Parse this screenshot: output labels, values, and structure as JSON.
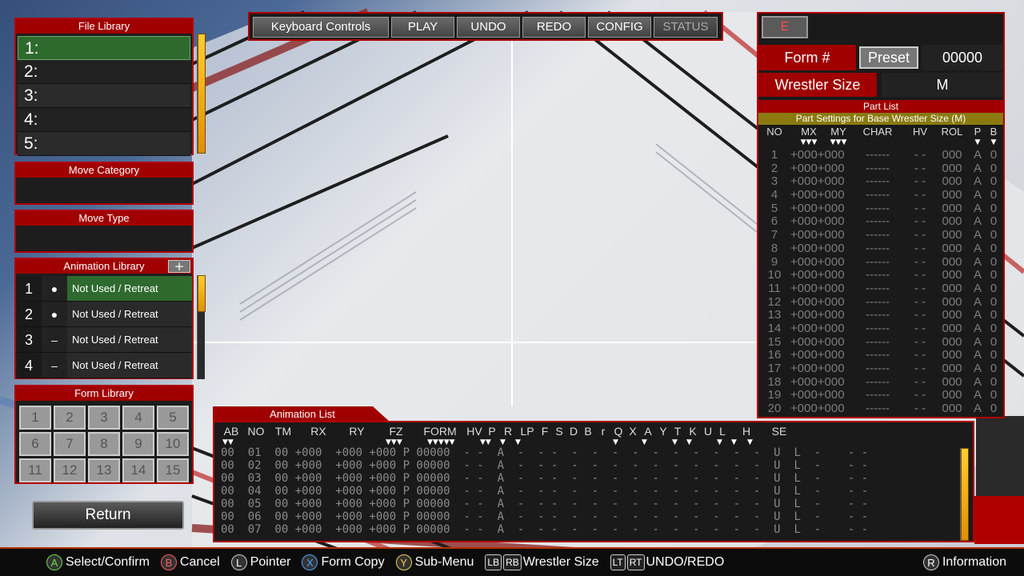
{
  "file_library": {
    "title": "File Library",
    "items": [
      "1:",
      "2:",
      "3:",
      "4:",
      "5:"
    ]
  },
  "move_category": {
    "title": "Move Category",
    "value": ""
  },
  "move_type": {
    "title": "Move Type",
    "value": ""
  },
  "animation_library": {
    "title": "Animation Library",
    "add_label": "+",
    "items": [
      {
        "num": "1",
        "icon": "●",
        "label": "Not Used / Retreat"
      },
      {
        "num": "2",
        "icon": "●",
        "label": "Not Used / Retreat"
      },
      {
        "num": "3",
        "icon": "–",
        "label": "Not Used / Retreat"
      },
      {
        "num": "4",
        "icon": "–",
        "label": "Not Used / Retreat"
      }
    ]
  },
  "form_library": {
    "title": "Form Library",
    "cells": [
      "1",
      "2",
      "3",
      "4",
      "5",
      "6",
      "7",
      "8",
      "9",
      "10",
      "11",
      "12",
      "13",
      "14",
      "15"
    ]
  },
  "return_label": "Return",
  "toolbar": {
    "keyboard": "Keyboard Controls",
    "play": "PLAY",
    "undo": "UNDO",
    "redo": "REDO",
    "config": "CONFIG",
    "status": "STATUS"
  },
  "right": {
    "e_label": "E",
    "form_label": "Form #",
    "preset_label": "Preset",
    "form_value": "00000",
    "size_label": "Wrestler Size",
    "size_value": "M",
    "part_list_title": "Part List",
    "part_settings": "Part Settings for Base Wrestler Size (M)",
    "headers": [
      "NO",
      "MX",
      "MY",
      "CHAR",
      "HV",
      "ROL",
      "P",
      "B"
    ],
    "rows": [
      "1",
      "2",
      "3",
      "4",
      "5",
      "6",
      "7",
      "8",
      "9",
      "10",
      "11",
      "12",
      "13",
      "14",
      "15",
      "16",
      "17",
      "18",
      "19",
      "20"
    ],
    "mxmy": "+000+000",
    "char": "------",
    "hv": "- -",
    "rol": "000",
    "p": "A",
    "b": "0"
  },
  "anim_list": {
    "title": "Animation List",
    "headers": [
      "AB",
      "NO",
      "TM",
      "RX",
      "RY",
      "FZ",
      "FORM",
      "HV",
      "P",
      "R",
      "LP",
      "F",
      "S",
      "D",
      "B",
      "r",
      "Q",
      "X",
      "A",
      "Y",
      "T",
      "K",
      "U",
      "L",
      "H",
      "SE"
    ],
    "rows": [
      "00  01  00 +000  +000 +000 P 00000  - -  A  -  - -  -  -  -  -  -  -  -  -  -  -  U  L  -    - -",
      "00  02  00 +000  +000 +000 P 00000  - -  A  -  - -  -  -  -  -  -  -  -  -  -  -  U  L  -    - -",
      "00  03  00 +000  +000 +000 P 00000  - -  A  -  - -  -  -  -  -  -  -  -  -  -  -  U  L  -    - -",
      "00  04  00 +000  +000 +000 P 00000  - -  A  -  - -  -  -  -  -  -  -  -  -  -  -  U  L  -    - -",
      "00  05  00 +000  +000 +000 P 00000  - -  A  -  - -  -  -  -  -  -  -  -  -  -  -  U  L  -    - -",
      "00  06  00 +000  +000 +000 P 00000  - -  A  -  - -  -  -  -  -  -  -  -  -  -  -  U  L  -    - -",
      "00  07  00 +000  +000 +000 P 00000  - -  A  -  - -  -  -  -  -  -  -  -  -  -  -  U  L  -    - -"
    ]
  },
  "hints": {
    "select": "Select/Confirm",
    "cancel": "Cancel",
    "pointer": "Pointer",
    "form_copy": "Form Copy",
    "submenu": "Sub-Menu",
    "wrestler_size": "Wrestler Size",
    "undo_redo": "UNDO/REDO",
    "info": "Information",
    "btn_a": "A",
    "btn_b": "B",
    "btn_l": "L",
    "btn_x": "X",
    "btn_y": "Y",
    "btn_lb": "LB",
    "btn_rb": "RB",
    "btn_lt": "LT",
    "btn_rt": "RT",
    "btn_r": "R"
  }
}
